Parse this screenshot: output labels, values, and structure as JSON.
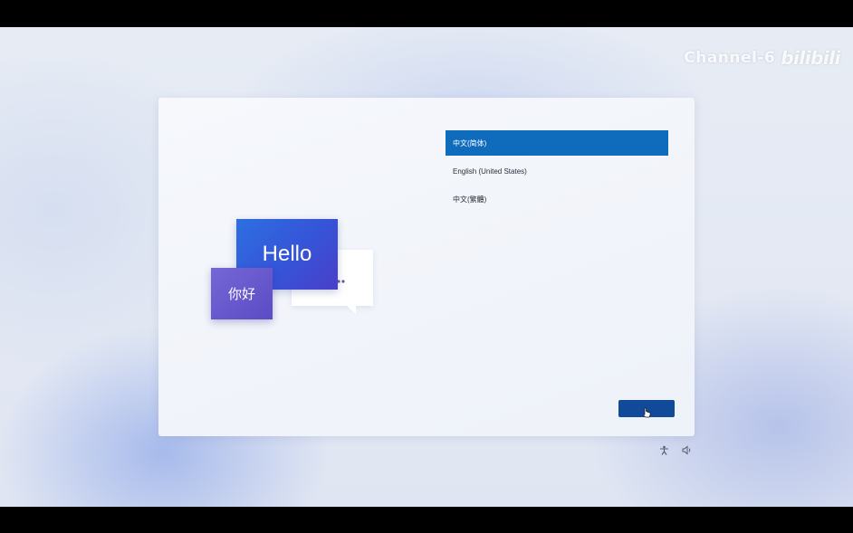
{
  "watermark": {
    "channel": "Channel-6",
    "logo": "bilibili"
  },
  "illustration": {
    "hello_text": "Hello",
    "nihao_text": "你好"
  },
  "languages": [
    {
      "label": "中文(简体)",
      "selected": true
    },
    {
      "label": "English (United States)",
      "selected": false
    },
    {
      "label": "中文(繁體)",
      "selected": false
    }
  ],
  "next_button": {
    "label": ""
  },
  "tray_icons": [
    "accessibility-icon",
    "volume-icon"
  ],
  "colors": {
    "accent": "#0f6cbd",
    "button": "#114a98",
    "hello_gradient": [
      "#2d6fe0",
      "#4a3fc9"
    ],
    "nihao_gradient": [
      "#7567d6",
      "#5c4bc5"
    ]
  }
}
